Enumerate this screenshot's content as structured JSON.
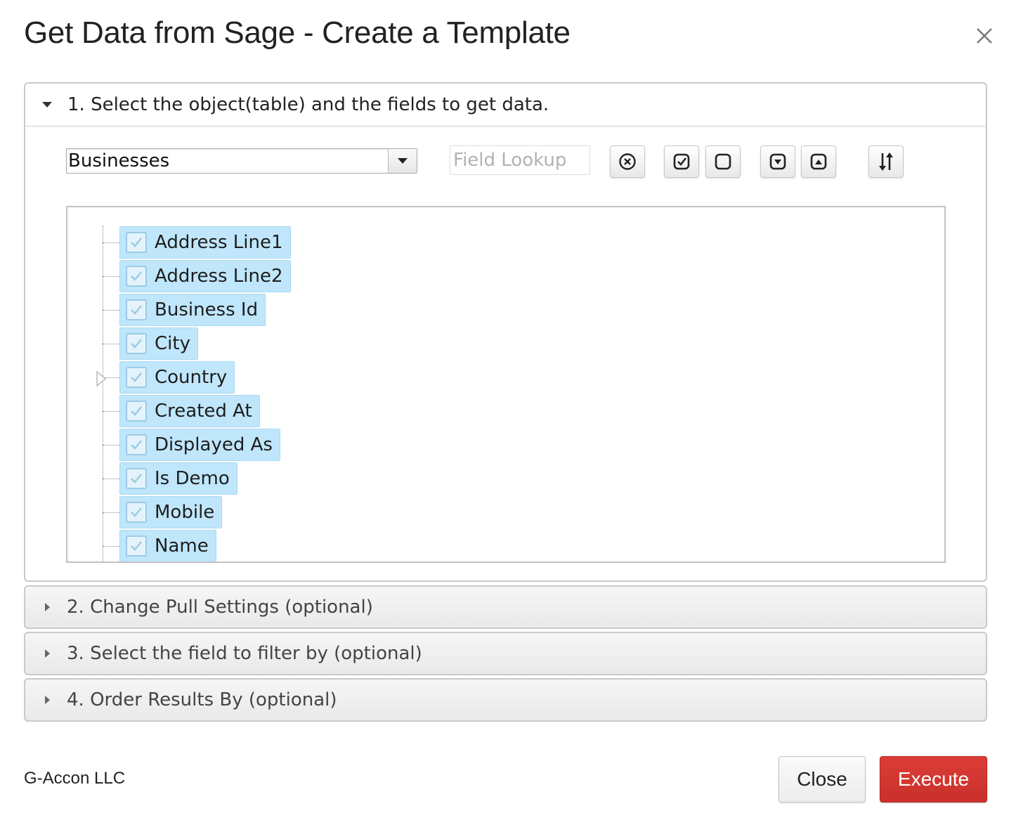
{
  "dialog": {
    "title": "Get Data from Sage - Create a Template"
  },
  "section1": {
    "header": "1. Select the object(table) and the fields to get data.",
    "object_select": "Businesses",
    "field_lookup_placeholder": "Field Lookup",
    "toolbar_icons": [
      "clear-circle-x-icon",
      "check-all-icon",
      "uncheck-all-icon",
      "expand-all-icon",
      "collapse-all-icon",
      "sort-icon"
    ],
    "fields": [
      {
        "label": "Address Line1",
        "checked": true
      },
      {
        "label": "Address Line2",
        "checked": true
      },
      {
        "label": "Business Id",
        "checked": true
      },
      {
        "label": "City",
        "checked": true
      },
      {
        "label": "Country",
        "checked": true,
        "expandable": true
      },
      {
        "label": "Created At",
        "checked": true
      },
      {
        "label": "Displayed As",
        "checked": true
      },
      {
        "label": "Is Demo",
        "checked": true
      },
      {
        "label": "Mobile",
        "checked": true
      },
      {
        "label": "Name",
        "checked": true
      }
    ]
  },
  "section2": {
    "header": "2. Change Pull Settings (optional)"
  },
  "section3": {
    "header": "3. Select the field to filter by (optional)"
  },
  "section4": {
    "header": "4. Order Results By (optional)"
  },
  "footer": {
    "company": "G-Accon LLC",
    "close_label": "Close",
    "execute_label": "Execute"
  },
  "colors": {
    "selected_node_bg": "#bfe6fb",
    "execute_bg": "#d2352f"
  }
}
